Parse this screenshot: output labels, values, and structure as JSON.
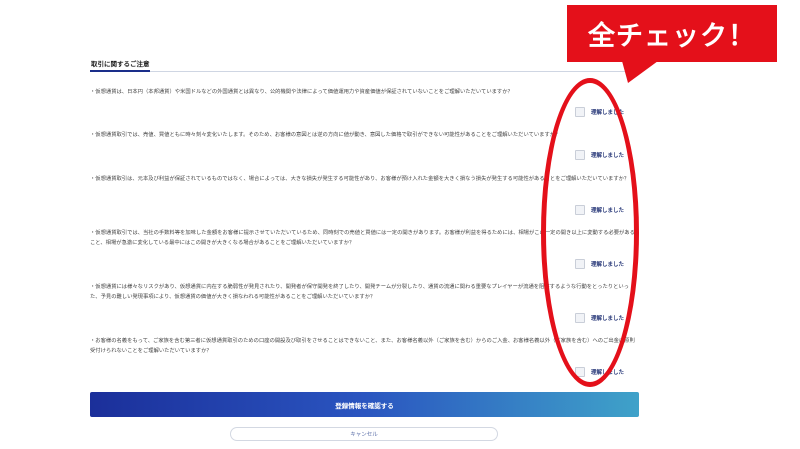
{
  "section": {
    "title": "取引に関するご注意"
  },
  "confirm_label": "理解しました",
  "items": [
    {
      "text": "・仮想通貨は、日本円（本邦通貨）や米国ドルなどの外国通貨とは異なり、公的機関や法律によって価値運用力や資産価値が保証されていないことをご理解いただいていますか？"
    },
    {
      "text": "・仮想通貨取引では、売値、買値ともに時々刻々変化いたします。そのため、お客様の意図とは逆の方向に値が動き、意図した価格で取引ができない可能性があることをご理解いただいていますか？"
    },
    {
      "text": "・仮想通貨取引は、元本及び利益が保証されているものではなく、場合によっては、大きな損失が発生する可能性があり、お客様が預け入れた金額を大きく損なう損失が発生する可能性があることをご理解いただいていますか？"
    },
    {
      "text": "・仮想通貨取引では、当社の手数料等を加味した金額をお客様に提示させていただいているため、同時刻での売値と買値には一定の開きがあります。お客様が利益を得るためには、相場がこの一定の開き以上に変動する必要があること、相場が急激に変化している最中にはこの開きが大きくなる場合があることをご理解いただいていますか？"
    },
    {
      "text": "・仮想通貨には様々なリスクがあり、仮想通貨に内在する脆弱性が発見されたり、開発者が保守開発を終了したり、開発チームが分裂したり、通貨の流通に関わる重要なプレイヤーが流通を阻害するような行動をとったりといった、予見の難しい発現事項により、仮想通貨の価値が大きく損なわれる可能性があることをご理解いただいていますか？"
    },
    {
      "text": "・お客様の名義をもって、ご家族を含む第三者に仮想通貨取引のための口座の開設及び取引をさせることはできないこと、また、お客様名義以外（ご家族を含む）からのご入金、お客様名義以外（ご家族を含む）へのご出金は原則受付けられないことをご理解いただいていますか？"
    }
  ],
  "buttons": {
    "confirm": "登録情報を確認する",
    "cancel": "キャンセル"
  },
  "annotation": {
    "callout_text": "全チェック！",
    "color": "#e4101a"
  }
}
